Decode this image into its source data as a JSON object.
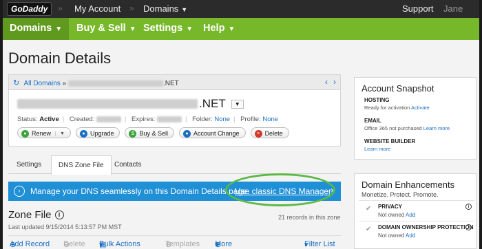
{
  "topbar": {
    "logo": "GoDaddy",
    "my_account": "My Account",
    "domains": "Domains",
    "support": "Support",
    "user": "Jane"
  },
  "nav": {
    "items": [
      "Domains",
      "Buy & Sell",
      "Settings",
      "Help"
    ],
    "active_color": "#5f9a1e",
    "bar_color": "#77b82a"
  },
  "page_title": "Domain Details",
  "domain_card": {
    "breadcrumb_link": "All Domains",
    "breadcrumb_sep": "»",
    "breadcrumb_tld": ".NET",
    "domain_tld": ".NET",
    "status_label": "Status:",
    "status_value": "Active",
    "created_label": "Created:",
    "expires_label": "Expires:",
    "folder_label": "Folder:",
    "folder_value": "None",
    "profile_label": "Profile:",
    "profile_value": "None",
    "buttons": [
      "Renew",
      "Upgrade",
      "Buy & Sell",
      "Account Change",
      "Delete"
    ]
  },
  "tabs": [
    "Settings",
    "DNS Zone File",
    "Contacts"
  ],
  "banner": {
    "message": "Manage your DNS seamlessly on this Domain Details page.",
    "link": "Use classic DNS Manager",
    "color": "#1f8fd6"
  },
  "zone": {
    "title": "Zone File",
    "updated": "Last updated 9/15/2014 5:13:57 PM MST",
    "count": "21 records in this zone",
    "toolbar": [
      "Add Record",
      "Delete",
      "Bulk Actions",
      "Templates",
      "More",
      "Filter List"
    ]
  },
  "snapshot": {
    "title": "Account Snapshot",
    "hosting_hd": "HOSTING",
    "hosting_text": "Ready for activation",
    "hosting_link": "Activate",
    "email_hd": "EMAIL",
    "email_text": "Office 365 not purchased",
    "email_link": "Learn more",
    "wb_hd": "WEBSITE BUILDER",
    "wb_link": "Learn more"
  },
  "enhancements": {
    "title": "Domain Enhancements",
    "subtitle": "Monetize. Protect. Promote.",
    "items": [
      {
        "title": "PRIVACY",
        "status": "Not owned",
        "link": "Add"
      },
      {
        "title": "DOMAIN OWNERSHIP PROTECTION",
        "status": "Not owned",
        "link": "Add"
      }
    ]
  }
}
